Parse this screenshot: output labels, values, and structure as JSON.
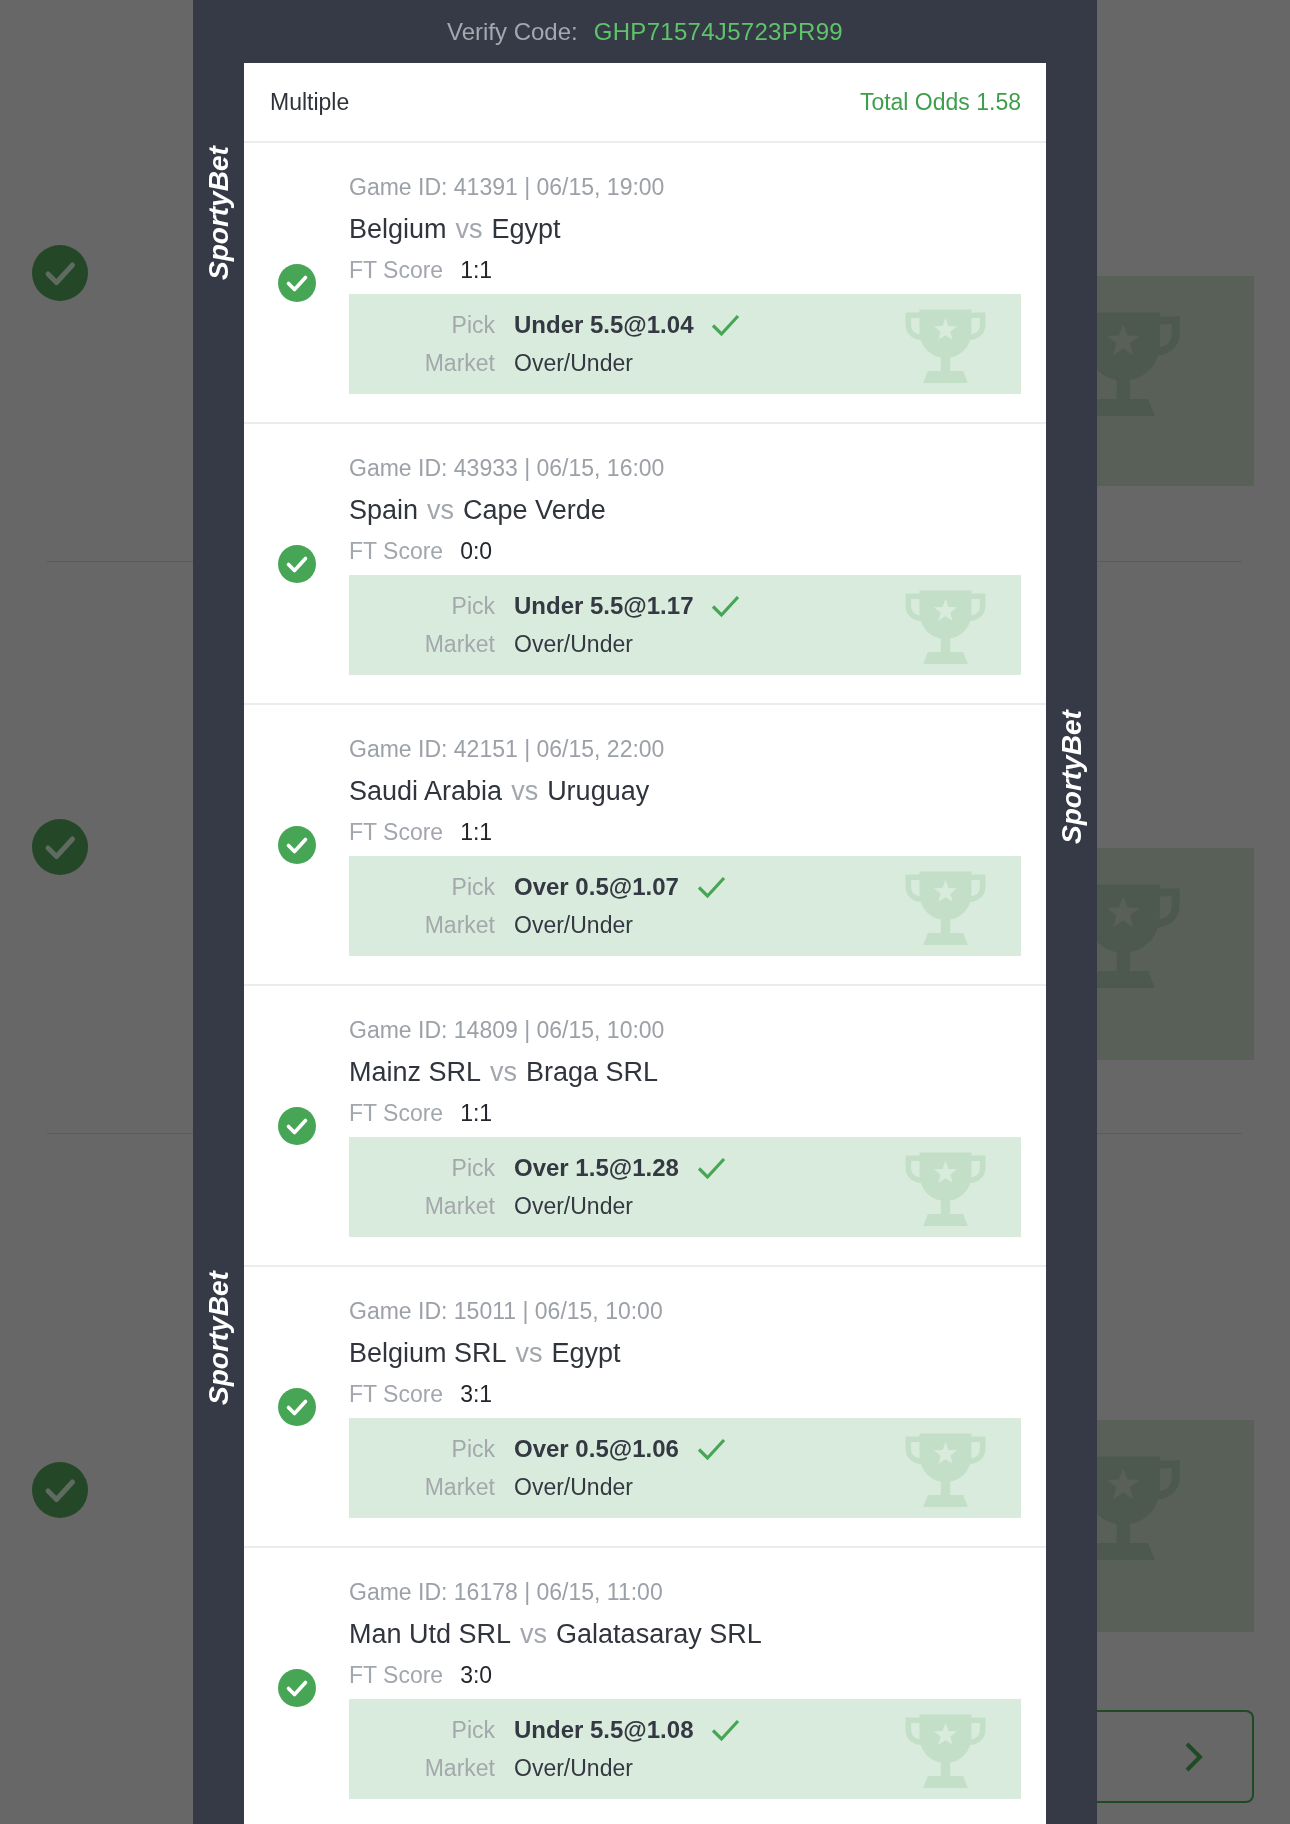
{
  "header": {
    "label": "Verify Code:",
    "code": "GHP71574J5723PR99"
  },
  "side_logos": {
    "left": [
      "SportyBet",
      "SportyBet"
    ],
    "right": [
      "SportyBet"
    ]
  },
  "ticket": {
    "type": "Multiple",
    "total_odds": "Total Odds 1.58"
  },
  "bets": [
    {
      "game": "Game ID: 41391 | 06/15, 19:00",
      "home": "Belgium",
      "vs": "vs",
      "away": "Egypt",
      "score_label": "FT Score",
      "score": "1:1",
      "pick_label": "Pick",
      "pick": "Under 5.5@1.04",
      "market_label": "Market",
      "market": "Over/Under",
      "won": true
    },
    {
      "game": "Game ID: 43933 | 06/15, 16:00",
      "home": "Spain",
      "vs": "vs",
      "away": "Cape Verde",
      "score_label": "FT Score",
      "score": "0:0",
      "pick_label": "Pick",
      "pick": "Under 5.5@1.17",
      "market_label": "Market",
      "market": "Over/Under",
      "won": true
    },
    {
      "game": "Game ID: 42151 | 06/15, 22:00",
      "home": "Saudi Arabia",
      "vs": "vs",
      "away": "Uruguay",
      "score_label": "FT Score",
      "score": "1:1",
      "pick_label": "Pick",
      "pick": "Over 0.5@1.07",
      "market_label": "Market",
      "market": "Over/Under",
      "won": true
    },
    {
      "game": "Game ID: 14809 | 06/15, 10:00",
      "home": "Mainz SRL",
      "vs": "vs",
      "away": "Braga SRL",
      "score_label": "FT Score",
      "score": "1:1",
      "pick_label": "Pick",
      "pick": "Over 1.5@1.28",
      "market_label": "Market",
      "market": "Over/Under",
      "won": true
    },
    {
      "game": "Game ID: 15011 | 06/15, 10:00",
      "home": "Belgium SRL",
      "vs": "vs",
      "away": "Egypt",
      "score_label": "FT Score",
      "score": "3:1",
      "pick_label": "Pick",
      "pick": "Over 0.5@1.06",
      "market_label": "Market",
      "market": "Over/Under",
      "won": true
    },
    {
      "game": "Game ID: 16178 | 06/15, 11:00",
      "home": "Man Utd SRL",
      "vs": "vs",
      "away": "Galatasaray SRL",
      "score_label": "FT Score",
      "score": "3:0",
      "pick_label": "Pick",
      "pick": "Under 5.5@1.08",
      "market_label": "Market",
      "market": "Over/Under",
      "won": true
    }
  ]
}
